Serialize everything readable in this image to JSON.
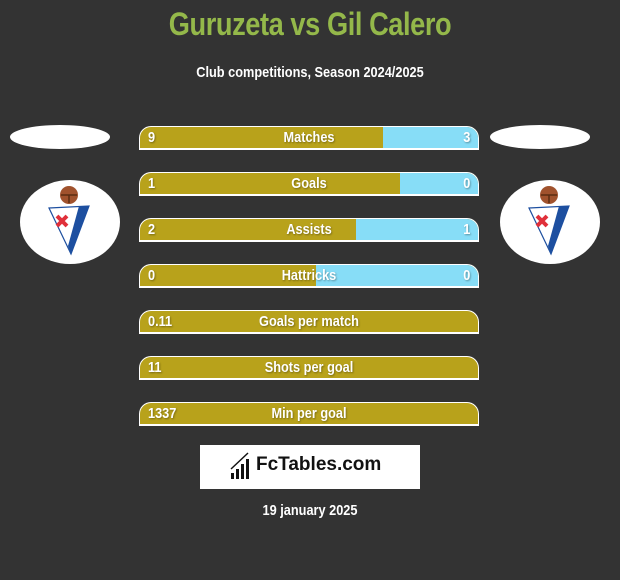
{
  "header": {
    "title": "Guruzeta vs Gil Calero",
    "subtitle": "Club competitions, Season 2024/2025"
  },
  "teams": {
    "left": {
      "badge_icon": "sd-eibar-crest-icon"
    },
    "right": {
      "badge_icon": "sd-eibar-crest-icon"
    }
  },
  "colors": {
    "title": "#94b84a",
    "left_bar": "#b8a21b",
    "right_bar": "#87ddf7",
    "background": "#333333"
  },
  "stats": [
    {
      "label": "Matches",
      "left": "9",
      "right": "3",
      "left_share": 0.72
    },
    {
      "label": "Goals",
      "left": "1",
      "right": "0",
      "left_share": 0.77
    },
    {
      "label": "Assists",
      "left": "2",
      "right": "1",
      "left_share": 0.64
    },
    {
      "label": "Hattricks",
      "left": "0",
      "right": "0",
      "left_share": 0.52
    },
    {
      "label": "Goals per match",
      "left": "0.11",
      "right": "",
      "left_share": 1
    },
    {
      "label": "Shots per goal",
      "left": "11",
      "right": "",
      "left_share": 1
    },
    {
      "label": "Min per goal",
      "left": "1337",
      "right": "",
      "left_share": 1
    }
  ],
  "footer": {
    "logo_text": "FcTables.com",
    "logo_icon": "bar-chart-icon",
    "date": "19 january 2025"
  }
}
